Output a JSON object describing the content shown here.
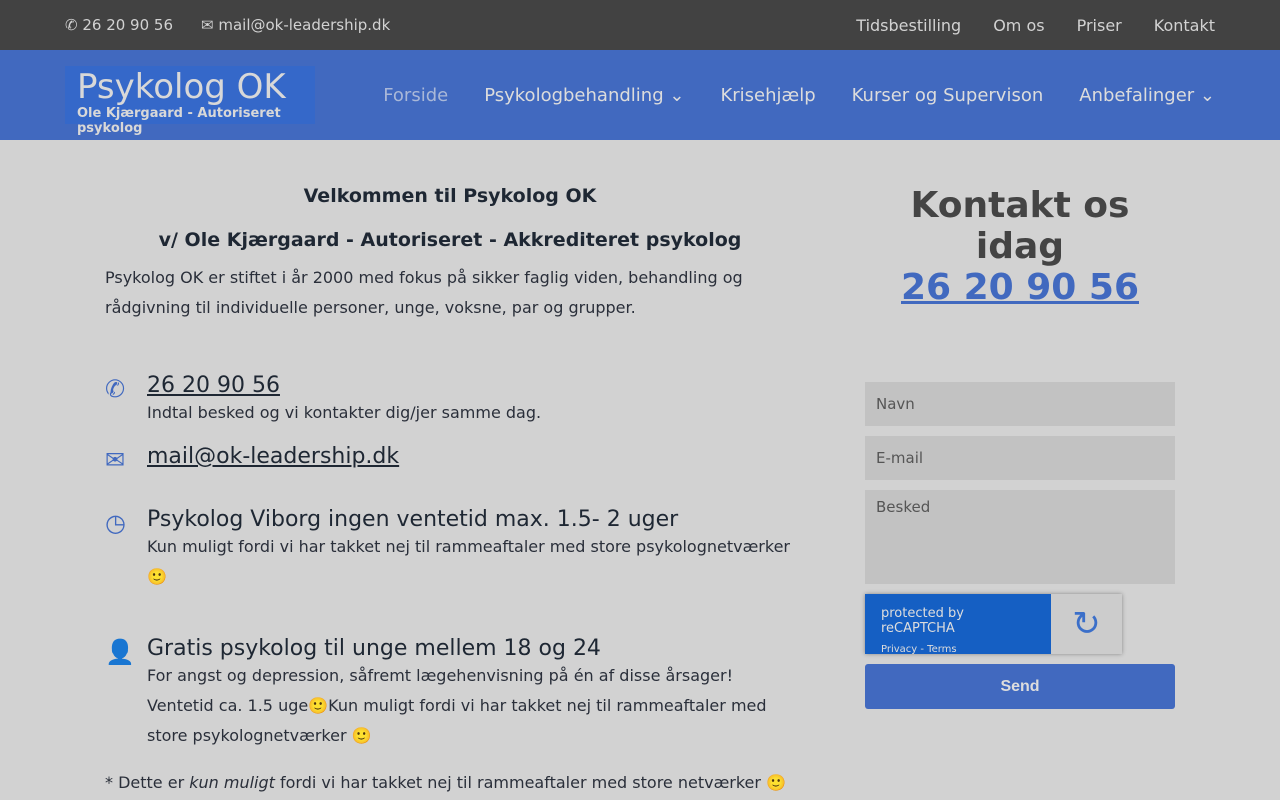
{
  "topbar": {
    "phone": "26 20 90 56",
    "email": "mail@ok-leadership.dk",
    "links": [
      "Tidsbestilling",
      "Om os",
      "Priser",
      "Kontakt"
    ]
  },
  "logo": {
    "title": "Psykolog OK",
    "subtitle": "Ole Kjærgaard - Autoriseret psykolog"
  },
  "nav": [
    "Forside",
    "Psykologbehandling",
    "Krisehjælp",
    "Kurser og Supervison",
    "Anbefalinger"
  ],
  "main": {
    "title": "Velkommen til Psykolog OK",
    "subtitle": "v/ Ole Kjærgaard - Autoriseret - Akkrediteret psykolog",
    "intro": "Psykolog OK er stiftet i år 2000 med fokus på sikker faglig viden, behandling og rådgivning til individuelle personer, unge, voksne, par og grupper.",
    "items": [
      {
        "heading": "26 20 90 56",
        "text": "Indtal besked og vi kontakter dig/jer samme dag."
      },
      {
        "heading": "mail@ok-leadership.dk",
        "text": ""
      },
      {
        "heading": "Psykolog Viborg ingen ventetid max. 1.5- 2 uger",
        "text": "Kun muligt fordi vi har takket nej til rammeaftaler med store psykolognetværker 🙂"
      },
      {
        "heading": "Gratis psykolog til unge mellem 18 og 24",
        "text": "For angst og depression, såfremt lægehenvisning på én af disse årsager! Ventetid ca. 1.5 uge🙂Kun muligt fordi vi har takket nej til rammeaftaler med store psykolognetværker 🙂"
      }
    ],
    "footnote_a": "* Dette er ",
    "footnote_em": "kun muligt",
    "footnote_b": " fordi vi har takket nej til rammeaftaler med store netværker 🙂"
  },
  "side": {
    "title": "Kontakt os idag",
    "phone": "26 20 90 56",
    "name_ph": "Navn",
    "email_ph": "E-mail",
    "msg_ph": "Besked",
    "captcha": "protected by reCAPTCHA",
    "captcha_links": "Privacy - Terms",
    "send": "Send"
  }
}
